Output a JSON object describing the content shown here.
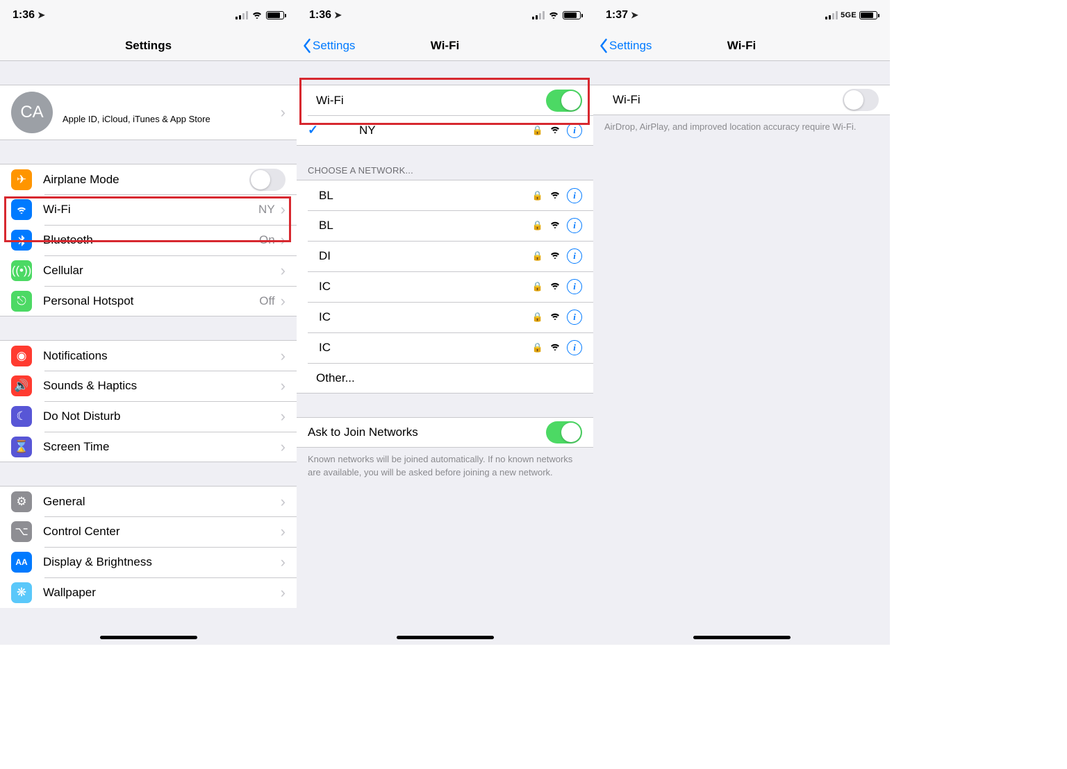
{
  "screen1": {
    "time": "1:36",
    "navTitle": "Settings",
    "avatarInitials": "CA",
    "appleIdSub": "Apple ID, iCloud, iTunes & App Store",
    "rows": {
      "airplane": {
        "label": "Airplane Mode"
      },
      "wifi": {
        "label": "Wi-Fi",
        "value": "NY"
      },
      "bluetooth": {
        "label": "Bluetooth",
        "value": "On"
      },
      "cellular": {
        "label": "Cellular"
      },
      "hotspot": {
        "label": "Personal Hotspot",
        "value": "Off"
      },
      "notifications": {
        "label": "Notifications"
      },
      "sounds": {
        "label": "Sounds & Haptics"
      },
      "dnd": {
        "label": "Do Not Disturb"
      },
      "screentime": {
        "label": "Screen Time"
      },
      "general": {
        "label": "General"
      },
      "controlcenter": {
        "label": "Control Center"
      },
      "display": {
        "label": "Display & Brightness"
      },
      "wallpaper": {
        "label": "Wallpaper"
      }
    }
  },
  "screen2": {
    "time": "1:36",
    "backLabel": "Settings",
    "navTitle": "Wi-Fi",
    "wifiToggleLabel": "Wi-Fi",
    "connectedNetwork": "NY",
    "chooseHeader": "CHOOSE A NETWORK...",
    "networks": [
      "BL",
      "BL",
      "DI",
      "IC",
      "IC",
      "IC"
    ],
    "otherLabel": "Other...",
    "askLabel": "Ask to Join Networks",
    "askFooter": "Known networks will be joined automatically. If no known networks are available, you will be asked before joining a new network."
  },
  "screen3": {
    "time": "1:37",
    "backLabel": "Settings",
    "navTitle": "Wi-Fi",
    "wifiToggleLabel": "Wi-Fi",
    "fiveG": "5GE",
    "footer": "AirDrop, AirPlay, and improved location accuracy require Wi-Fi."
  }
}
